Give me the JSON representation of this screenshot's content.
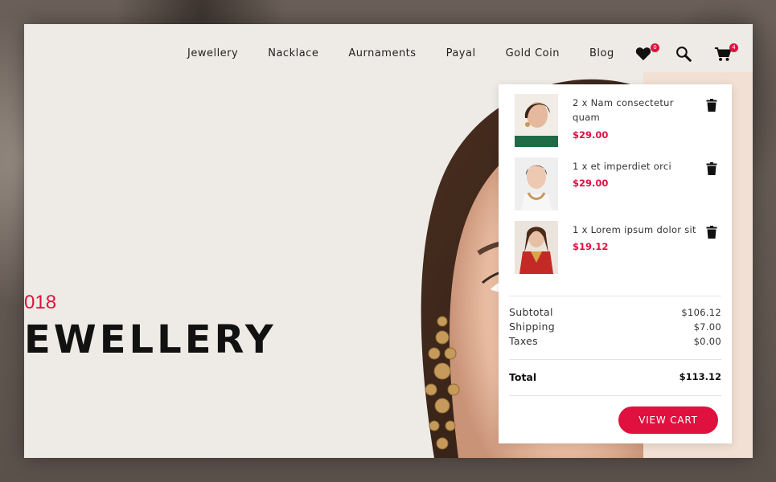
{
  "nav": {
    "links": [
      "Jewellery",
      "Nacklace",
      "Aurnaments",
      "Payal",
      "Gold Coin",
      "Blog"
    ],
    "wishlist_count": "0",
    "cart_count": "4"
  },
  "hero": {
    "year": "018",
    "title": "EWELLERY"
  },
  "cart": {
    "items": [
      {
        "name": "2 x Nam consectetur quam",
        "price": "$29.00"
      },
      {
        "name": "1 x et imperdiet orci",
        "price": "$29.00"
      },
      {
        "name": "1 x Lorem ipsum dolor sit",
        "price": "$19.12"
      }
    ],
    "subtotal_label": "Subtotal",
    "subtotal_value": "$106.12",
    "shipping_label": "Shipping",
    "shipping_value": "$7.00",
    "taxes_label": "Taxes",
    "taxes_value": "$0.00",
    "total_label": "Total",
    "total_value": "$113.12",
    "view_cart_label": "VIEW CART"
  },
  "colors": {
    "accent": "#e0103f",
    "background": "#eeebe6"
  },
  "icons": [
    "heart-icon",
    "search-icon",
    "cart-icon",
    "trash-icon"
  ]
}
